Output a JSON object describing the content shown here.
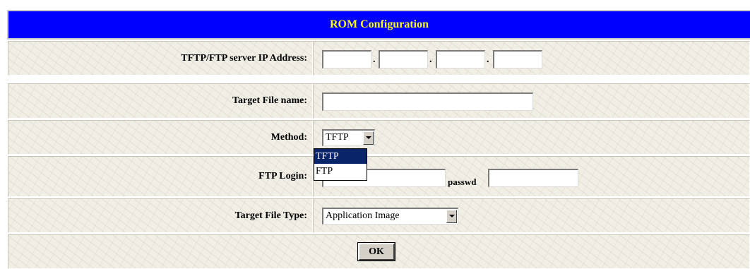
{
  "header": {
    "title": "ROM Configuration"
  },
  "rows": {
    "ip": {
      "label": "TFTP/FTP server IP Address:",
      "octets": [
        "",
        "",
        "",
        ""
      ]
    },
    "filename": {
      "label": "Target File name:",
      "value": ""
    },
    "method": {
      "label": "Method:",
      "selected": "TFTP",
      "options": [
        "TFTP",
        "FTP"
      ]
    },
    "ftp_login": {
      "label": "FTP Login:",
      "value": "",
      "passwd_label": "passwd",
      "passwd_value": ""
    },
    "file_type": {
      "label": "Target File Type:",
      "selected": "Application Image"
    }
  },
  "ok_button": {
    "label": "OK"
  }
}
